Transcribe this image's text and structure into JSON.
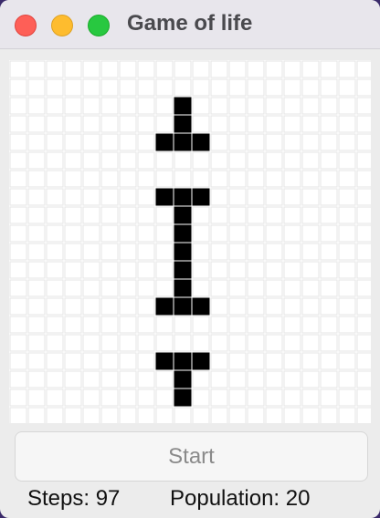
{
  "window": {
    "title": "Game of life",
    "controls": [
      "close-button",
      "minimize-button",
      "zoom-button"
    ]
  },
  "board": {
    "columns": 20,
    "rows": 20,
    "cell_color": "#000000",
    "grid_color": "#e6e6e6",
    "live_cells": [
      [
        9,
        2
      ],
      [
        9,
        3
      ],
      [
        8,
        4
      ],
      [
        9,
        4
      ],
      [
        10,
        4
      ],
      [
        8,
        7
      ],
      [
        9,
        7
      ],
      [
        10,
        7
      ],
      [
        9,
        8
      ],
      [
        9,
        9
      ],
      [
        9,
        10
      ],
      [
        9,
        11
      ],
      [
        9,
        12
      ],
      [
        8,
        13
      ],
      [
        9,
        13
      ],
      [
        10,
        13
      ],
      [
        8,
        16
      ],
      [
        9,
        16
      ],
      [
        10,
        16
      ],
      [
        9,
        17
      ],
      [
        9,
        18
      ]
    ]
  },
  "controls": {
    "start_label": "Start"
  },
  "status": {
    "steps_text": "Steps: 97",
    "population_text": "Population: 20"
  }
}
